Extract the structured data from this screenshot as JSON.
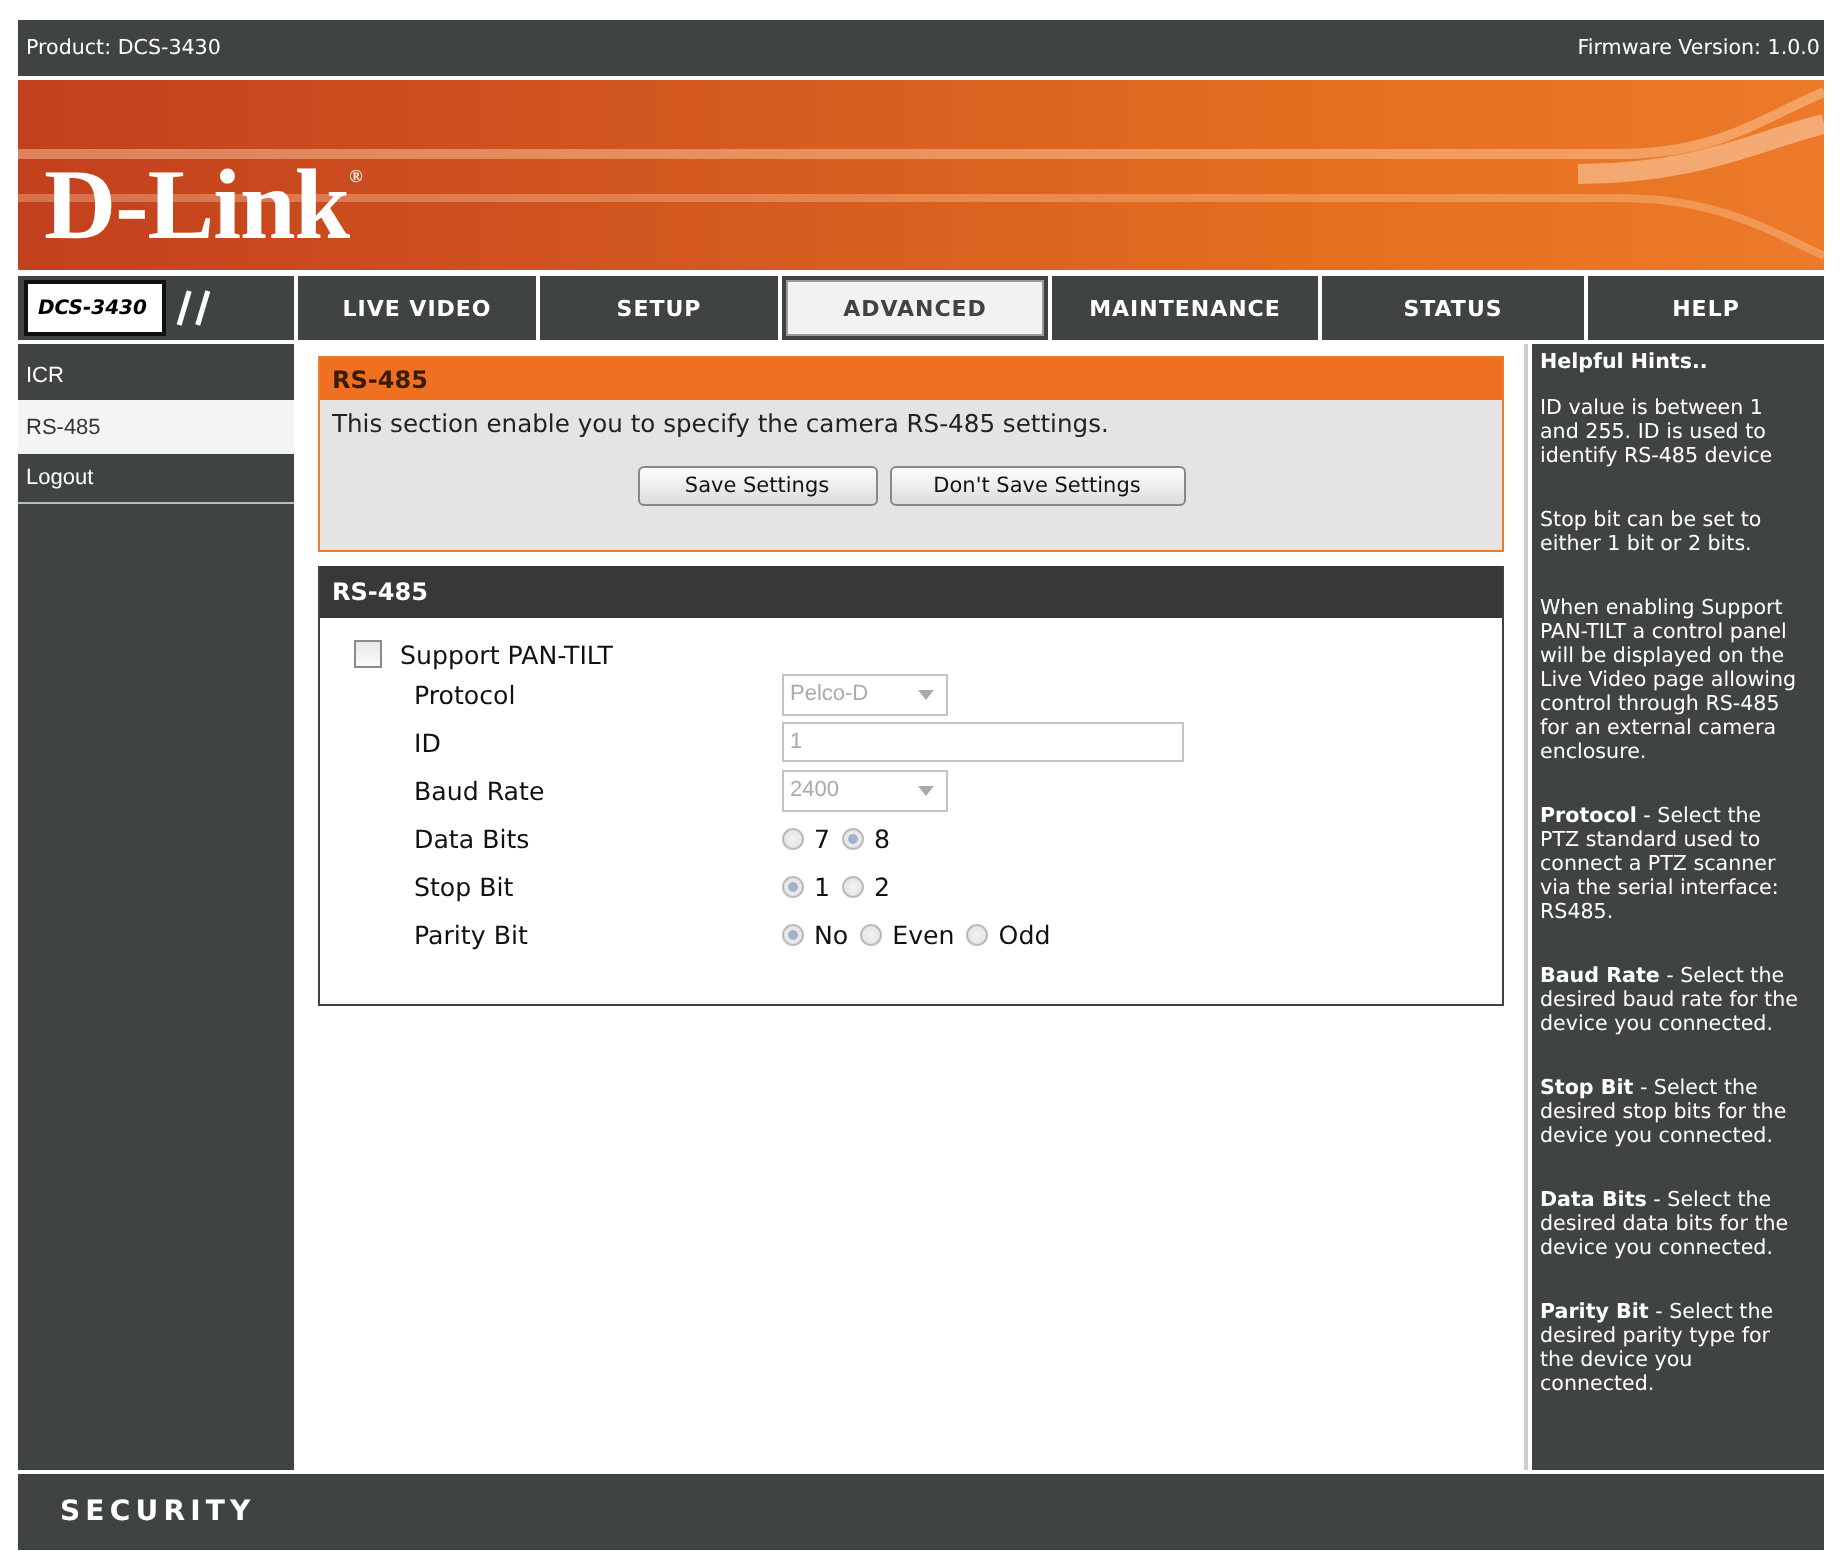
{
  "top_bar": {
    "product": "Product: DCS-3430",
    "firmware": "Firmware Version: 1.0.0"
  },
  "banner": {
    "logo": "D-Link$^{®}$"
  },
  "nav": {
    "model": "DCS-3430",
    "tabs": [
      {
        "label": "LIVE VIDEO",
        "selected": false
      },
      {
        "label": "SETUP",
        "selected": false
      },
      {
        "label": "ADVANCED",
        "selected": true
      },
      {
        "label": "MAINTENANCE",
        "selected": false
      },
      {
        "label": "STATUS",
        "selected": false
      },
      {
        "label": "HELP",
        "selected": false
      }
    ]
  },
  "sidebar": {
    "items": [
      {
        "label": "ICR",
        "selected": false
      },
      {
        "label": "RS-485",
        "selected": true
      },
      {
        "label": "Logout",
        "selected": false
      }
    ]
  },
  "intro_panel": {
    "title": "RS-485",
    "text": "This section enable you to specify the camera RS-485 settings.",
    "buttons": [
      "Save Settings",
      "Don't Save Settings"
    ]
  },
  "settings_panel": {
    "title": "RS-485",
    "checkbox": {
      "label": "Support PAN-TILT",
      "checked": false
    },
    "fields": [
      {
        "kind": "select",
        "label": "Protocol",
        "value": "Pelco-D",
        "disabled": true
      },
      {
        "kind": "text",
        "label": "ID",
        "value": "1",
        "disabled": true
      },
      {
        "kind": "select",
        "label": "Baud Rate",
        "value": "2400",
        "disabled": true
      },
      {
        "kind": "radio",
        "label": "Data Bits",
        "disabled": true,
        "options": [
          {
            "label": "7",
            "selected": false
          },
          {
            "label": "8",
            "selected": true
          }
        ]
      },
      {
        "kind": "radio",
        "label": "Stop Bit",
        "disabled": true,
        "options": [
          {
            "label": "1",
            "selected": true
          },
          {
            "label": "2",
            "selected": false
          }
        ]
      },
      {
        "kind": "radio",
        "label": "Parity Bit",
        "disabled": true,
        "options": [
          {
            "label": "No",
            "selected": true
          },
          {
            "label": "Even",
            "selected": false
          },
          {
            "label": "Odd",
            "selected": false
          }
        ]
      }
    ]
  },
  "help": {
    "title": "Helpful Hints..",
    "paragraphs": [
      "ID value is between 1 and 255. ID is used to identify RS-485 device",
      "Stop bit can be set to either 1 bit or 2 bits.",
      "When enabling Support PAN-TILT a control panel will be displayed on the Live Video page allowing control through RS-485 for an external camera enclosure.",
      "**Protocol** - Select the PTZ standard used to connect a PTZ scanner via the serial interface: RS485.",
      "**Baud Rate** - Select the desired baud rate for the device you connected.",
      "**Stop Bit** - Select the desired stop bits for the device you connected.",
      "**Data Bits** - Select the desired data bits for the device you connected.",
      "**Parity Bit** - Select the desired parity type for the device you connected."
    ]
  },
  "footer": {
    "brand": "SECURITY"
  }
}
